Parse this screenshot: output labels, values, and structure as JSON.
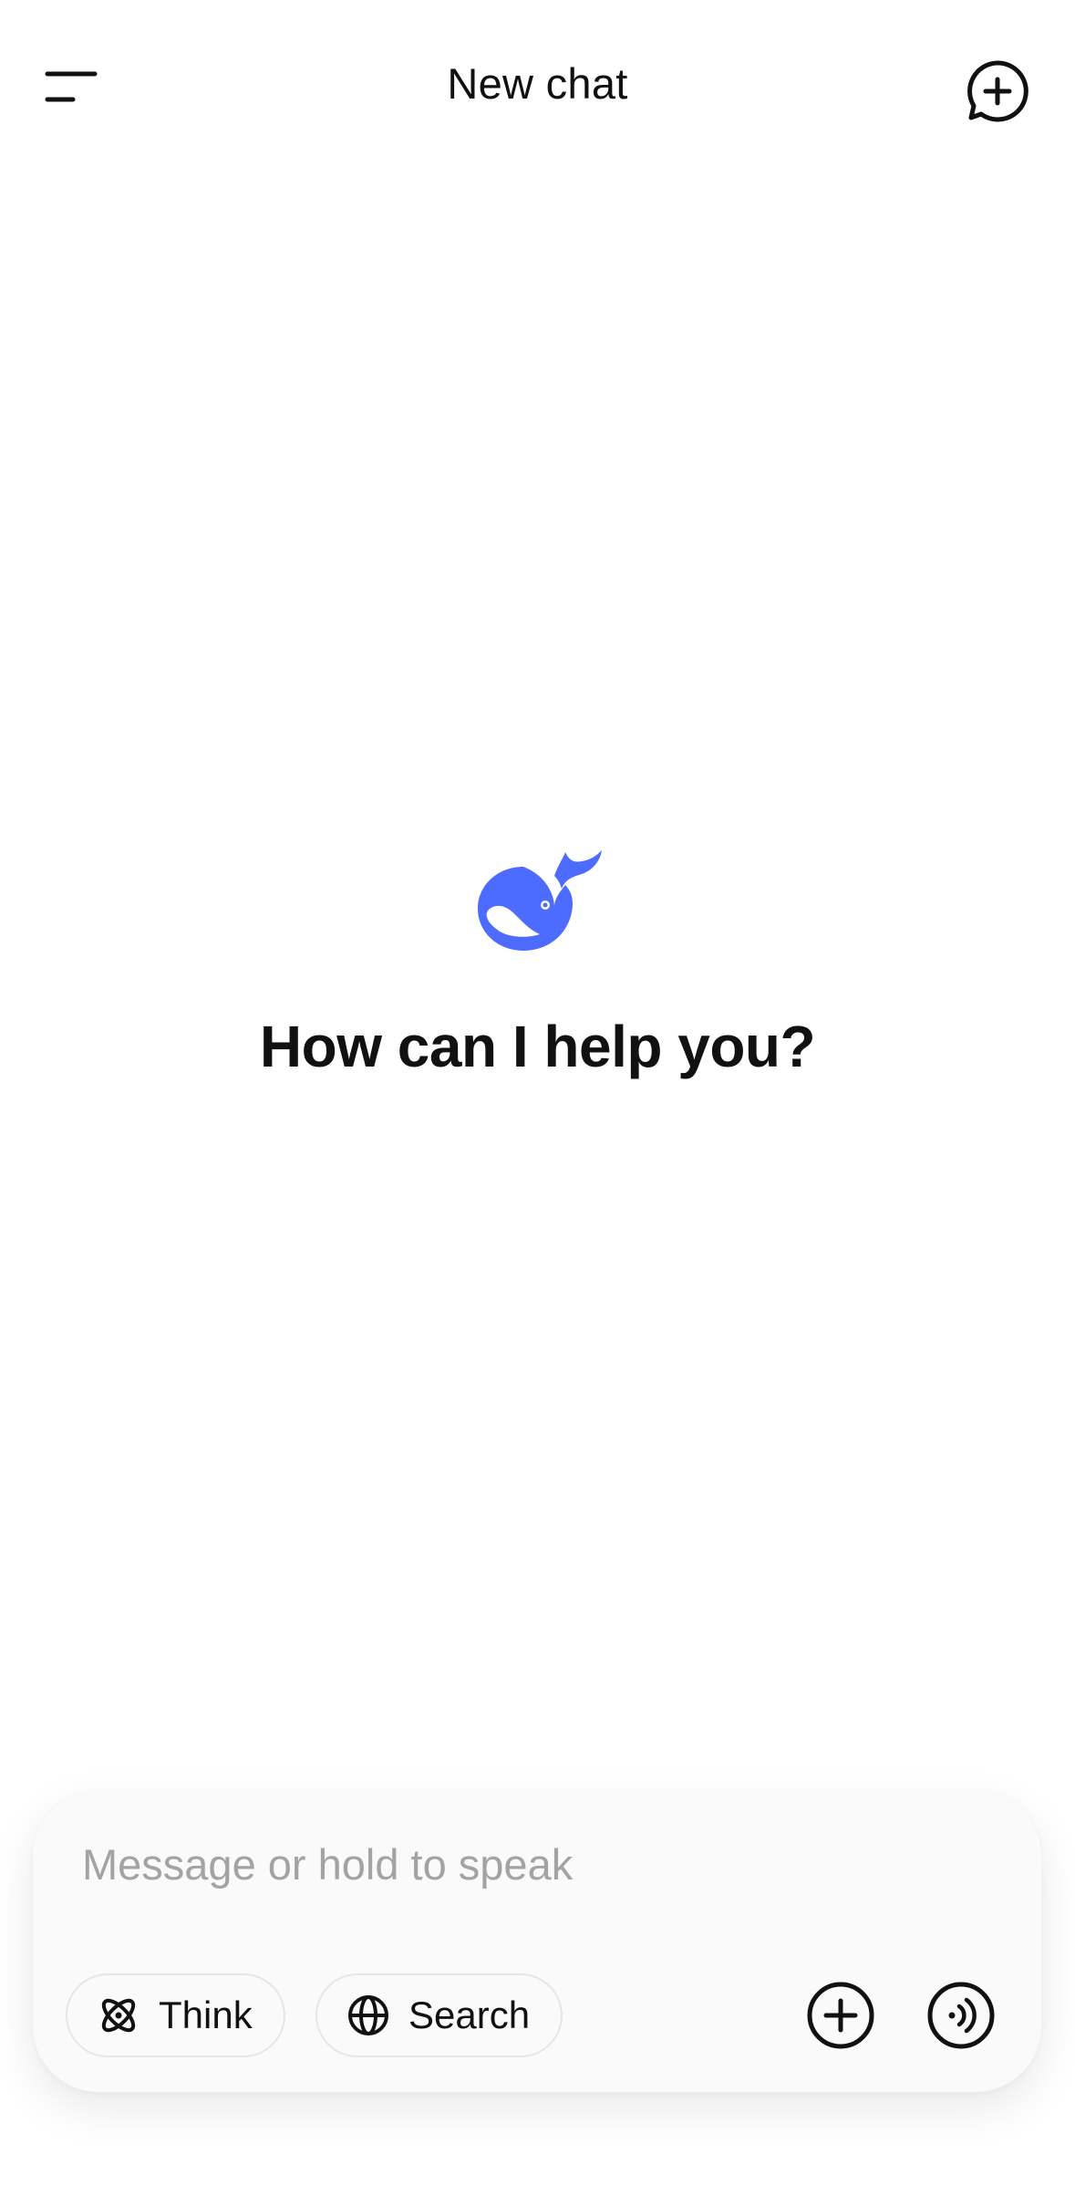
{
  "header": {
    "title": "New chat",
    "menu_icon": "sidebar-menu-icon",
    "new_chat_icon": "new-chat-icon"
  },
  "hero": {
    "logo_icon": "whale-logo-icon",
    "prompt": "How can I help you?",
    "logo_color": "#4D6BFE"
  },
  "composer": {
    "placeholder": "Message or hold to speak",
    "value": "",
    "chips": [
      {
        "label": "Think",
        "icon": "atom-icon"
      },
      {
        "label": "Search",
        "icon": "globe-icon"
      }
    ],
    "attach_icon": "plus-circle-icon",
    "voice_icon": "voice-wave-icon"
  }
}
